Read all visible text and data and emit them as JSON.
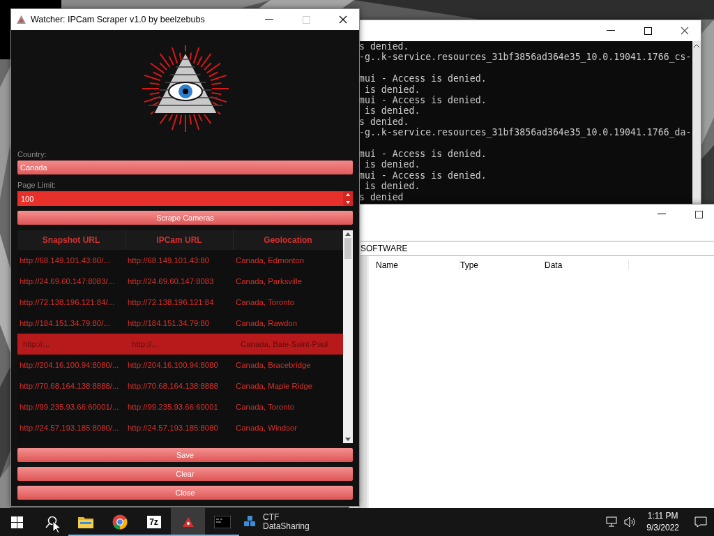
{
  "desktop": {
    "icon_labels": [
      "CTF",
      "DataSharing"
    ]
  },
  "console": {
    "lines": [
      {
        "kind": "text",
        "text": "s denied."
      },
      {
        "kind": "text",
        "text": "-g..k-service.resources_31bf3856ad364e35_10.0.19041.1766_cs-"
      },
      {
        "kind": "blank"
      },
      {
        "kind": "text",
        "text": "mui - Access is denied."
      },
      {
        "kind": "text",
        "text": " is denied."
      },
      {
        "kind": "text",
        "text": "mui - Access is denied."
      },
      {
        "kind": "text",
        "text": " is denied."
      },
      {
        "kind": "text",
        "text": "s denied."
      },
      {
        "kind": "text",
        "text": "-g..k-service.resources_31bf3856ad364e35_10.0.19041.1766_da-"
      },
      {
        "kind": "blank"
      },
      {
        "kind": "text",
        "text": "mui - Access is denied."
      },
      {
        "kind": "text",
        "text": " is denied."
      },
      {
        "kind": "text",
        "text": "mui - Access is denied."
      },
      {
        "kind": "text",
        "text": " is denied."
      },
      {
        "kind": "text",
        "text": "s denied"
      }
    ]
  },
  "registry": {
    "path": "SOFTWARE",
    "columns": [
      "Name",
      "Type",
      "Data"
    ]
  },
  "watcher": {
    "title": "Watcher: IPCam Scraper v1.0 by beelzebubs",
    "country_label": "Country:",
    "country": "Canada",
    "page_limit_label": "Page Limit:",
    "page_limit": "100",
    "scrape_button": "Scrape Cameras",
    "table": {
      "columns": [
        "Snapshot URL",
        "IPCam URL",
        "Geolocation"
      ],
      "rows": [
        {
          "cells": [
            "http://68.149.101.43:80/...",
            "http://68.149.101.43:80",
            "Canada, Edmonton"
          ],
          "selected": false
        },
        {
          "cells": [
            "http://24.69.60.147:8083/...",
            "http://24.69.60.147:8083",
            "Canada, Parksville"
          ],
          "selected": false
        },
        {
          "cells": [
            "http://72.138.196.121:84/...",
            "http://72.138.196.121:84",
            "Canada, Toronto"
          ],
          "selected": false
        },
        {
          "cells": [
            "http://184.151.34.79:80/...",
            "http://184.151.34.79:80",
            "Canada, Rawdon"
          ],
          "selected": false
        },
        {
          "cells": [
            "http://...",
            "http://...",
            "Canada, Baie-Saint-Paul"
          ],
          "selected": true
        },
        {
          "cells": [
            "http://204.16.100.94:8080/...",
            "http://204.16.100.94:8080",
            "Canada, Bracebridge"
          ],
          "selected": false
        },
        {
          "cells": [
            "http://70.68.164.138:8888/...",
            "http://70.68.164.138:8888",
            "Canada, Maple Ridge"
          ],
          "selected": false
        },
        {
          "cells": [
            "http://99.235.93.66:60001/...",
            "http://99.235.93.66:60001",
            "Canada, Toronto"
          ],
          "selected": false
        },
        {
          "cells": [
            "http://24.57.193.185:8080/...",
            "http://24.57.193.185:8080",
            "Canada, Windsor"
          ],
          "selected": false
        }
      ]
    },
    "buttons": [
      "Save",
      "Clear",
      "Close"
    ]
  },
  "taskbar": {
    "apps": [
      {
        "kind": "start",
        "running": false,
        "selected": false
      },
      {
        "kind": "search",
        "running": false,
        "selected": false
      },
      {
        "kind": "folder",
        "running": true,
        "selected": false
      },
      {
        "kind": "chrome",
        "running": true,
        "selected": false
      },
      {
        "kind": "archiver",
        "label": "7z",
        "running": true,
        "selected": false
      },
      {
        "kind": "watcher",
        "running": true,
        "selected": true
      },
      {
        "kind": "terminal",
        "running": true,
        "selected": false
      }
    ],
    "time": "1:11 PM",
    "date": "9/3/2022"
  }
}
